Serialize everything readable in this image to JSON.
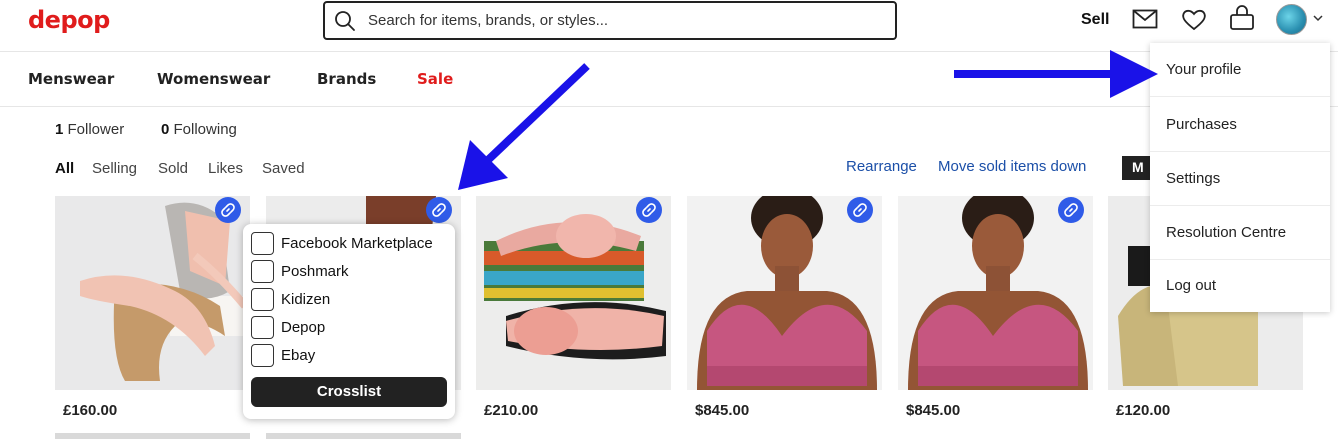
{
  "header": {
    "logo": "depop",
    "search_placeholder": "Search for items, brands, or styles...",
    "sell_label": "Sell"
  },
  "categories": [
    "Menswear",
    "Womenswear",
    "Brands",
    "Sale"
  ],
  "profile_stats": {
    "followers_count": "1",
    "followers_label": "Follower",
    "following_count": "0",
    "following_label": "Following"
  },
  "tabs": [
    "All",
    "Selling",
    "Sold",
    "Likes",
    "Saved"
  ],
  "actions": {
    "rearrange": "Rearrange",
    "move_sold": "Move sold items down",
    "dark_button": "M"
  },
  "products": [
    {
      "price": "£160.00"
    },
    {
      "price": ""
    },
    {
      "price": "£210.00"
    },
    {
      "price": "$845.00"
    },
    {
      "price": "$845.00"
    },
    {
      "price": "£120.00"
    }
  ],
  "crosslist_popup": {
    "options": [
      "Facebook Marketplace",
      "Poshmark",
      "Kidizen",
      "Depop",
      "Ebay"
    ],
    "button_label": "Crosslist"
  },
  "profile_menu": {
    "items": [
      "Your profile",
      "Purchases",
      "Settings",
      "Resolution Centre",
      "Log out"
    ]
  },
  "colors": {
    "brand_red": "#e01c1c",
    "link_blue": "#1b4fa8",
    "badge_blue": "#2f5be8",
    "annotation_arrow": "#1a12e8"
  }
}
